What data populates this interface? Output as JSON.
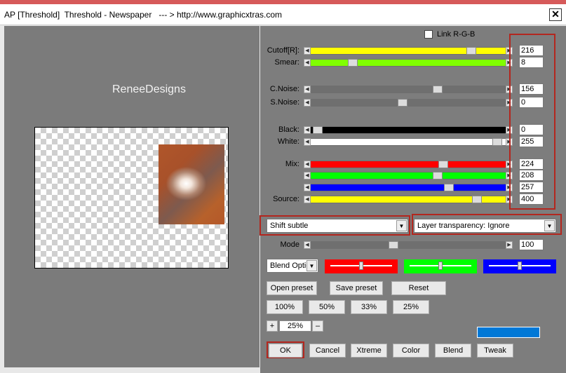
{
  "window": {
    "title": "AP [Threshold]  Threshold - Newspaper   --- > http://www.graphicxtras.com",
    "close_glyph": "✕"
  },
  "preview": {
    "brand": "ReneeDesigns"
  },
  "controls": {
    "link_rgb_label": "Link R-G-B",
    "link_rgb_checked": false,
    "sliders": [
      {
        "label": "Cutoff[R]:",
        "value": "216",
        "fill": "#ffff00",
        "position": 0.84
      },
      {
        "label": "Smear:",
        "value": "8",
        "fill": "#80ff00",
        "position": 0.2
      },
      {
        "label": "C.Noise:",
        "value": "156",
        "fill": "#6f6f6f",
        "position": 0.66
      },
      {
        "label": "S.Noise:",
        "value": "0",
        "fill": "#6f6f6f",
        "position": 0.47
      },
      {
        "label": "Black:",
        "value": "0",
        "fill": "#000000",
        "position": 0.01
      },
      {
        "label": "White:",
        "value": "255",
        "fill": "#ffffff",
        "position": 0.98
      },
      {
        "label": "Mix:",
        "value": "224",
        "fill": "#ff0000",
        "position": 0.69
      },
      {
        "label": "",
        "value": "208",
        "fill": "#00ff00",
        "position": 0.66
      },
      {
        "label": "",
        "value": "257",
        "fill": "#0000ff",
        "position": 0.72
      },
      {
        "label": "Source:",
        "value": "400",
        "fill": "#ffff00",
        "position": 0.87
      }
    ],
    "mode_select": "Shift subtle",
    "layer_select": "Layer transparency: Ignore",
    "mode_label": "Mode",
    "mode_value": "100",
    "mode_position": 0.42,
    "blend_select": "Blend Optio",
    "rgb_sliders": [
      {
        "color": "#ff0000",
        "position": 0.5
      },
      {
        "color": "#00ff00",
        "position": 0.5
      },
      {
        "color": "#0000ff",
        "position": 0.5
      }
    ]
  },
  "buttons": {
    "open_preset": "Open preset",
    "save_preset": "Save preset",
    "reset": "Reset",
    "zoom_100": "100%",
    "zoom_50": "50%",
    "zoom_33": "33%",
    "zoom_25": "25%",
    "plus": "+",
    "minus": "–",
    "zoom_value": "25%",
    "ok": "OK",
    "cancel": "Cancel",
    "xtreme": "Xtreme",
    "color": "Color",
    "blend": "Blend",
    "tweak": "Tweak"
  },
  "colors": {
    "highlight_red": "#b3261e",
    "progress_blue": "#0078d7"
  }
}
